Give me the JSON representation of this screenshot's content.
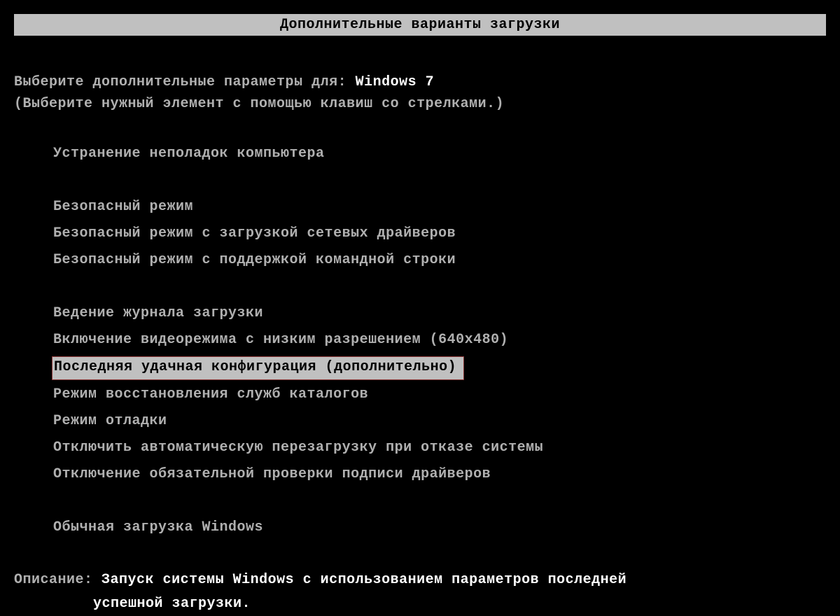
{
  "title": "Дополнительные варианты загрузки",
  "prompt_prefix": "Выберите дополнительные параметры для:",
  "os_name": "Windows 7",
  "hint": "(Выберите нужный элемент с помощью клавиш со стрелками.)",
  "menu": {
    "group1": [
      "Устранение неполадок компьютера"
    ],
    "group2": [
      "Безопасный режим",
      "Безопасный режим с загрузкой сетевых драйверов",
      "Безопасный режим с поддержкой командной строки"
    ],
    "group3": [
      "Ведение журнала загрузки",
      "Включение видеорежима с низким разрешением (640x480)",
      "Последняя удачная конфигурация (дополнительно)",
      "Режим восстановления служб каталогов",
      "Режим отладки",
      "Отключить автоматическую перезагрузку при отказе системы",
      "Отключение обязательной проверки подписи драйверов"
    ],
    "group4": [
      "Обычная загрузка Windows"
    ],
    "selected_index": 2,
    "selected_group": "group3"
  },
  "description_label": "Описание:",
  "description_line1": "Запуск системы Windows с использованием параметров последней",
  "description_line2": "успешной загрузки."
}
